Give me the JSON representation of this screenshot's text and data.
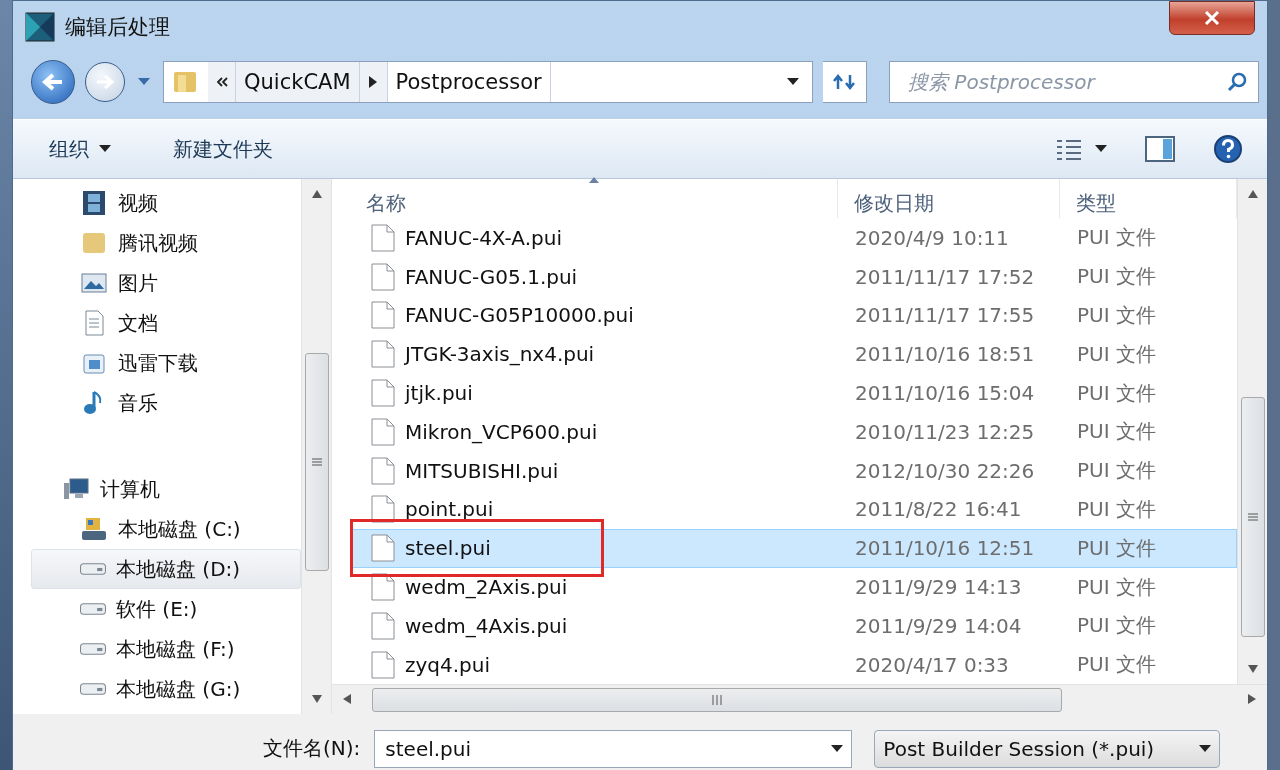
{
  "window": {
    "title": "编辑后处理"
  },
  "address": {
    "crumbs": [
      "QuickCAM",
      "Postprocessor"
    ]
  },
  "search": {
    "placeholder": "搜索 Postprocessor"
  },
  "toolbar": {
    "organize": "组织",
    "new_folder": "新建文件夹"
  },
  "sidebar": {
    "items": [
      {
        "label": "视频",
        "kind": "video",
        "selected": false
      },
      {
        "label": "腾讯视频",
        "kind": "folder",
        "selected": false
      },
      {
        "label": "图片",
        "kind": "picture",
        "selected": false
      },
      {
        "label": "文档",
        "kind": "document",
        "selected": false
      },
      {
        "label": "迅雷下载",
        "kind": "download",
        "selected": false
      },
      {
        "label": "音乐",
        "kind": "music",
        "selected": false
      },
      {
        "label": "计算机",
        "kind": "computer",
        "selected": false
      },
      {
        "label": "本地磁盘 (C:)",
        "kind": "system-drive",
        "selected": false
      },
      {
        "label": "本地磁盘 (D:)",
        "kind": "drive",
        "selected": true
      },
      {
        "label": "软件 (E:)",
        "kind": "drive",
        "selected": false
      },
      {
        "label": "本地磁盘 (F:)",
        "kind": "drive",
        "selected": false
      },
      {
        "label": "本地磁盘 (G:)",
        "kind": "drive",
        "selected": false
      }
    ]
  },
  "table": {
    "columns": [
      {
        "label": "名称",
        "sorted": true
      },
      {
        "label": "修改日期",
        "sorted": false
      },
      {
        "label": "类型",
        "sorted": false
      }
    ],
    "rows": [
      {
        "name": "FANUC-4X-A.pui",
        "modified": "2020/4/9 10:11",
        "type": "PUI 文件",
        "selected": false,
        "highlighted": false
      },
      {
        "name": "FANUC-G05.1.pui",
        "modified": "2011/11/17 17:52",
        "type": "PUI 文件",
        "selected": false,
        "highlighted": false
      },
      {
        "name": "FANUC-G05P10000.pui",
        "modified": "2011/11/17 17:55",
        "type": "PUI 文件",
        "selected": false,
        "highlighted": false
      },
      {
        "name": "JTGK-3axis_nx4.pui",
        "modified": "2011/10/16 18:51",
        "type": "PUI 文件",
        "selected": false,
        "highlighted": false
      },
      {
        "name": "jtjk.pui",
        "modified": "2011/10/16 15:04",
        "type": "PUI 文件",
        "selected": false,
        "highlighted": false
      },
      {
        "name": "Mikron_VCP600.pui",
        "modified": "2010/11/23 12:25",
        "type": "PUI 文件",
        "selected": false,
        "highlighted": false
      },
      {
        "name": "MITSUBISHI.pui",
        "modified": "2012/10/30 22:26",
        "type": "PUI 文件",
        "selected": false,
        "highlighted": false
      },
      {
        "name": "point.pui",
        "modified": "2011/8/22 16:41",
        "type": "PUI 文件",
        "selected": false,
        "highlighted": false
      },
      {
        "name": "steel.pui",
        "modified": "2011/10/16 12:51",
        "type": "PUI 文件",
        "selected": true,
        "highlighted": true
      },
      {
        "name": "wedm_2Axis.pui",
        "modified": "2011/9/29 14:13",
        "type": "PUI 文件",
        "selected": false,
        "highlighted": false
      },
      {
        "name": "wedm_4Axis.pui",
        "modified": "2011/9/29 14:04",
        "type": "PUI 文件",
        "selected": false,
        "highlighted": false
      },
      {
        "name": "zyq4.pui",
        "modified": "2020/4/17 0:33",
        "type": "PUI 文件",
        "selected": false,
        "highlighted": false
      }
    ]
  },
  "footer": {
    "filename_label": "文件名(N):",
    "filename": "steel.pui",
    "file_type": "Post Builder Session (*.pui)"
  }
}
